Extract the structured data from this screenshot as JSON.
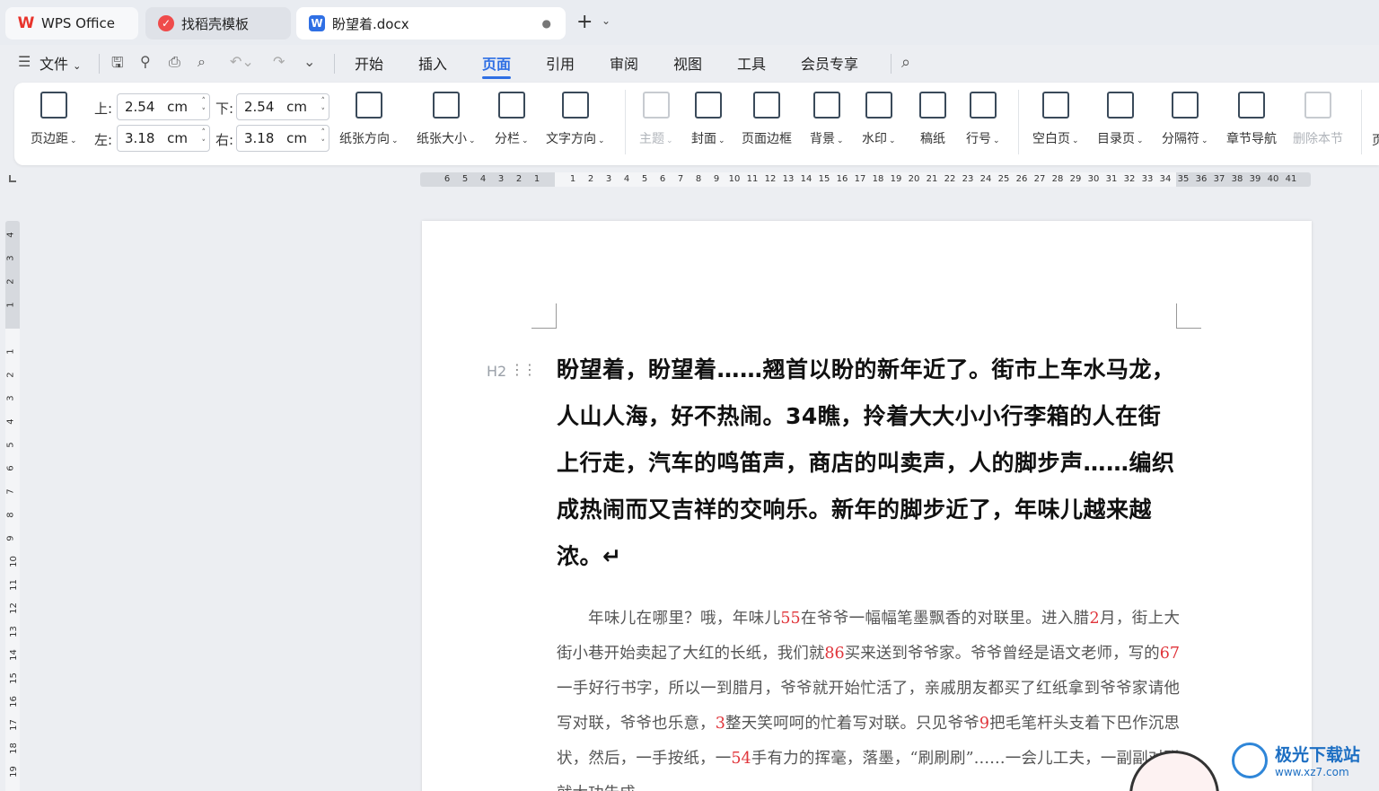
{
  "tabs": {
    "wps": "WPS Office",
    "daoke": "找稻壳模板",
    "doc": "盼望着.docx",
    "doc_icon": "W"
  },
  "menu": {
    "file": "文件",
    "items": [
      "开始",
      "插入",
      "页面",
      "引用",
      "审阅",
      "视图",
      "工具",
      "会员专享"
    ],
    "active": "页面"
  },
  "ribbon": {
    "margins_label": "页边距",
    "top_label": "上:",
    "top_value": "2.54",
    "bottom_label": "下:",
    "bottom_value": "2.54",
    "left_label": "左:",
    "left_value": "3.18",
    "right_label": "右:",
    "right_value": "3.18",
    "unit": "cm",
    "orientation": "纸张方向",
    "size": "纸张大小",
    "columns": "分栏",
    "text_direction": "文字方向",
    "theme": "主题",
    "cover": "封面",
    "page_border": "页面边框",
    "background": "背景",
    "watermark": "水印",
    "manuscript": "稿纸",
    "line_number": "行号",
    "blank_page": "空白页",
    "toc_page": "目录页",
    "separator": "分隔符",
    "chapter_nav": "章节导航",
    "delete_section": "删除本节",
    "more": "页"
  },
  "ruler": {
    "h_left": [
      "6",
      "5",
      "4",
      "3",
      "2",
      "1"
    ],
    "h_right": [
      "1",
      "2",
      "3",
      "4",
      "5",
      "6",
      "7",
      "8",
      "9",
      "10",
      "11",
      "12",
      "13",
      "14",
      "15",
      "16",
      "17",
      "18",
      "19",
      "20",
      "21",
      "22",
      "23",
      "24",
      "25",
      "26",
      "27",
      "28",
      "29",
      "30",
      "31",
      "32",
      "33",
      "34",
      "35",
      "36",
      "37",
      "38",
      "39",
      "40",
      "41"
    ],
    "v_top": [
      "4",
      "3",
      "2",
      "1"
    ],
    "v_body": [
      "1",
      "2",
      "3",
      "4",
      "5",
      "6",
      "7",
      "8",
      "9",
      "10",
      "11",
      "12",
      "13",
      "14",
      "15",
      "16",
      "17",
      "18",
      "19"
    ]
  },
  "document": {
    "heading_marker": "H2",
    "heading": "盼望着，盼望着……翘首以盼的新年近了。街市上车水马龙，人山人海，好不热闹。34瞧，拎着大大小小行李箱的人在街上行走，汽车的鸣笛声，商店的叫卖声，人的脚步声……编织成热闹而又吉祥的交响乐。新年的脚步近了，年味儿越来越浓。↵",
    "body_segments": [
      {
        "t": "年味儿在哪里？哦，年味儿"
      },
      {
        "n": "55"
      },
      {
        "t": "在爷爷一幅幅笔墨飘香的对联里。进入腊"
      },
      {
        "n": "2"
      },
      {
        "t": "月，街上大街小巷开始卖起了大红的长纸，我们就"
      },
      {
        "n": "86"
      },
      {
        "t": "买来送到爷爷家。爷爷曾经是语文老师，写的"
      },
      {
        "n": "67"
      },
      {
        "t": "一手好行书字，所以一到腊月，爷爷就开始忙活了，亲戚朋友都买了红纸拿到爷爷家请他写对联，爷爷也乐意，"
      },
      {
        "n": "3"
      },
      {
        "t": "整天笑呵呵的忙着写对联。只见爷爷"
      },
      {
        "n": "9"
      },
      {
        "t": "把毛笔杆头支着下巴作沉思状，然后，一手按纸，一"
      },
      {
        "n": "54"
      },
      {
        "t": "手有力的挥毫，落墨，“刷刷刷”……一会儿工夫，一副副对联就大功告成"
      }
    ]
  },
  "watermark": {
    "title": "极光下载站",
    "url": "www.xz7.com"
  }
}
